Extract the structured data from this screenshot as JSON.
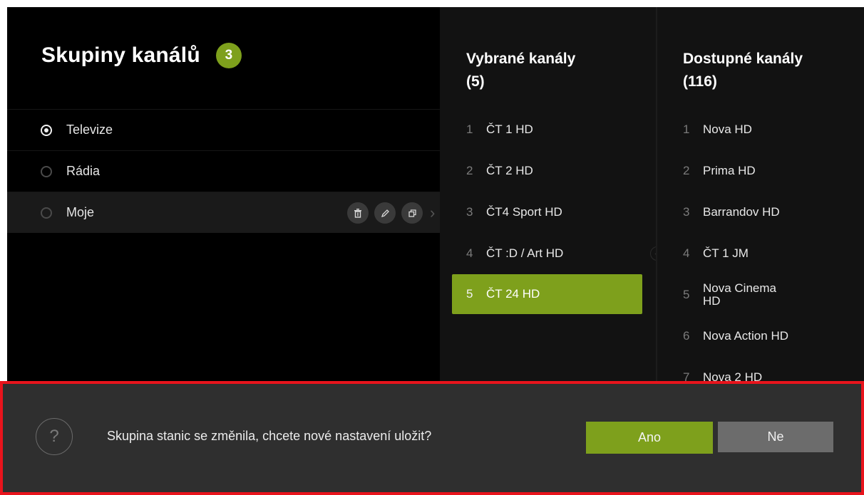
{
  "groups": {
    "title": "Skupiny kanálů",
    "count": "3",
    "items": [
      {
        "label": "Televize"
      },
      {
        "label": "Rádia"
      },
      {
        "label": "Moje"
      }
    ]
  },
  "selected": {
    "title_line1": "Vybrané kanály",
    "title_line2": "(5)",
    "channels": [
      {
        "num": "1",
        "name": "ČT 1 HD"
      },
      {
        "num": "2",
        "name": "ČT 2 HD"
      },
      {
        "num": "3",
        "name": "ČT4 Sport HD"
      },
      {
        "num": "4",
        "name": "ČT :D / Art HD"
      },
      {
        "num": "5",
        "name": "ČT 24 HD"
      }
    ]
  },
  "available": {
    "title_line1": "Dostupné kanály",
    "title_line2": "(116)",
    "channels": [
      {
        "num": "1",
        "name": "Nova HD"
      },
      {
        "num": "2",
        "name": "Prima HD"
      },
      {
        "num": "3",
        "name": "Barrandov HD"
      },
      {
        "num": "4",
        "name": "ČT 1 JM"
      },
      {
        "num": "5",
        "name": "Nova Cinema HD"
      },
      {
        "num": "6",
        "name": "Nova Action HD"
      },
      {
        "num": "7",
        "name": "Nova 2 HD"
      }
    ]
  },
  "dialog": {
    "message": "Skupina stanic se změnila, chcete nové nastavení uložit?",
    "yes_label": "Ano",
    "no_label": "Ne"
  },
  "colors": {
    "accent": "#7ea01c",
    "dialog_border": "#e8141c"
  }
}
